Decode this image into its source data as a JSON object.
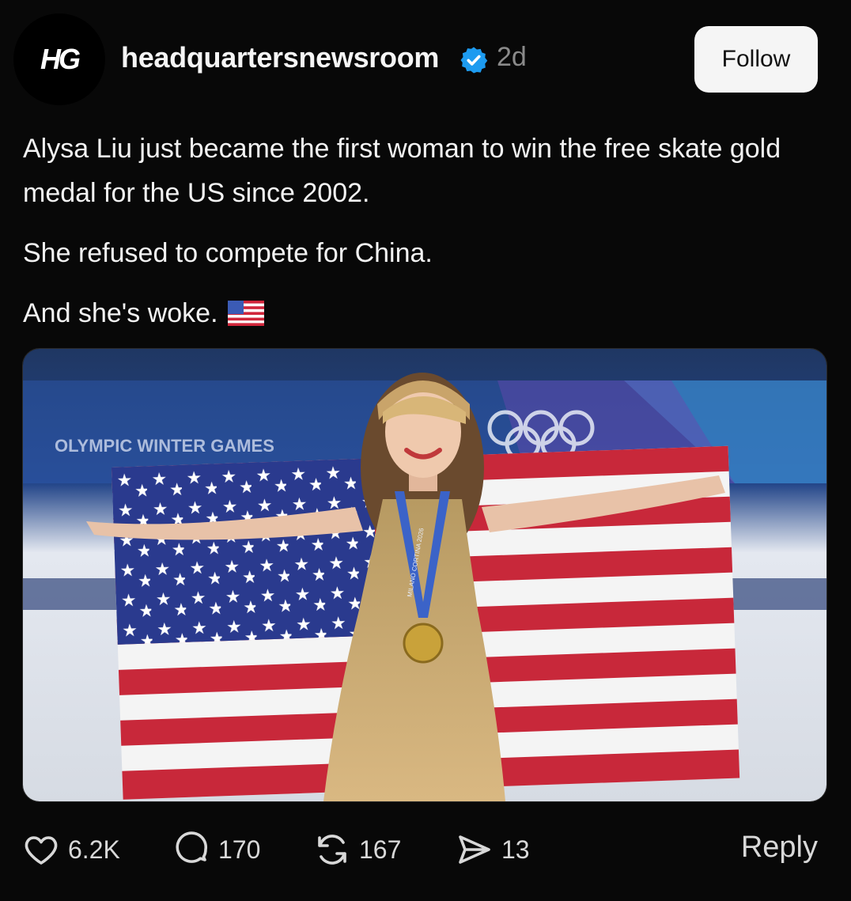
{
  "post": {
    "avatar_text": "HG",
    "username": "headquartersnewsroom",
    "timestamp": "2d",
    "follow_label": "Follow",
    "text_lines": [
      "Alysa Liu just became the first woman to win the free skate gold medal for the US since 2002.",
      "She refused to compete for China.",
      "And she's woke."
    ],
    "emoji": "us-flag-emoji",
    "image": {
      "description": "skater-holding-us-flag",
      "banner_text": "OLYMPIC WINTER GAMES",
      "ribbon_text": "MILANO CORTINA 2026"
    }
  },
  "actions": {
    "likes": "6.2K",
    "comments": "170",
    "reposts": "167",
    "shares": "13",
    "reply_label": "Reply"
  },
  "colors": {
    "accent_blue": "#1d9bf0",
    "background": "#080808",
    "flag_red": "#c8283a",
    "flag_blue": "#2a3a8e"
  }
}
